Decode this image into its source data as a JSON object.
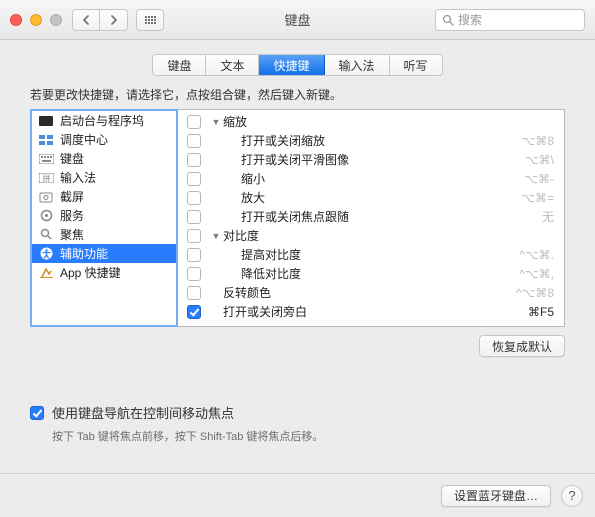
{
  "window": {
    "title": "键盘"
  },
  "search": {
    "placeholder": "搜索"
  },
  "tabs": [
    "键盘",
    "文本",
    "快捷键",
    "输入法",
    "听写"
  ],
  "active_tab": 2,
  "instructions": "若要更改快捷键，请选择它，点按组合键，然后键入新键。",
  "categories": [
    {
      "label": "启动台与程序坞",
      "icon": "launchpad"
    },
    {
      "label": "调度中心",
      "icon": "mission"
    },
    {
      "label": "键盘",
      "icon": "keyboard"
    },
    {
      "label": "输入法",
      "icon": "input"
    },
    {
      "label": "截屏",
      "icon": "screenshot"
    },
    {
      "label": "服务",
      "icon": "services"
    },
    {
      "label": "聚焦",
      "icon": "spotlight"
    },
    {
      "label": "辅助功能",
      "icon": "accessibility"
    },
    {
      "label": "App 快捷键",
      "icon": "appshortcuts"
    }
  ],
  "selected_category": 7,
  "shortcuts": [
    {
      "level": 1,
      "checked": false,
      "label": "缩放",
      "shortcut": "",
      "group": true
    },
    {
      "level": 2,
      "checked": false,
      "label": "打开或关闭缩放",
      "shortcut": "⌥⌘8"
    },
    {
      "level": 2,
      "checked": false,
      "label": "打开或关闭平滑图像",
      "shortcut": "⌥⌘\\"
    },
    {
      "level": 2,
      "checked": false,
      "label": "缩小",
      "shortcut": "⌥⌘-"
    },
    {
      "level": 2,
      "checked": false,
      "label": "放大",
      "shortcut": "⌥⌘="
    },
    {
      "level": 2,
      "checked": false,
      "label": "打开或关闭焦点跟随",
      "shortcut": "无"
    },
    {
      "level": 1,
      "checked": false,
      "label": "对比度",
      "shortcut": "",
      "group": true
    },
    {
      "level": 2,
      "checked": false,
      "label": "提高对比度",
      "shortcut": "^⌥⌘."
    },
    {
      "level": 2,
      "checked": false,
      "label": "降低对比度",
      "shortcut": "^⌥⌘,"
    },
    {
      "level": 1,
      "checked": false,
      "label": "反转颜色",
      "shortcut": "^⌥⌘8"
    },
    {
      "level": 1,
      "checked": true,
      "label": "打开或关闭旁白",
      "shortcut": "⌘F5",
      "enabled": true
    }
  ],
  "restore_button": "恢复成默认",
  "full_keyboard_access": {
    "checked": true,
    "label": "使用键盘导航在控制间移动焦点",
    "hint": "按下 Tab 键将焦点前移，按下 Shift-Tab 键将焦点后移。"
  },
  "footer": {
    "bluetooth_button": "设置蓝牙键盘…",
    "help": "?"
  }
}
